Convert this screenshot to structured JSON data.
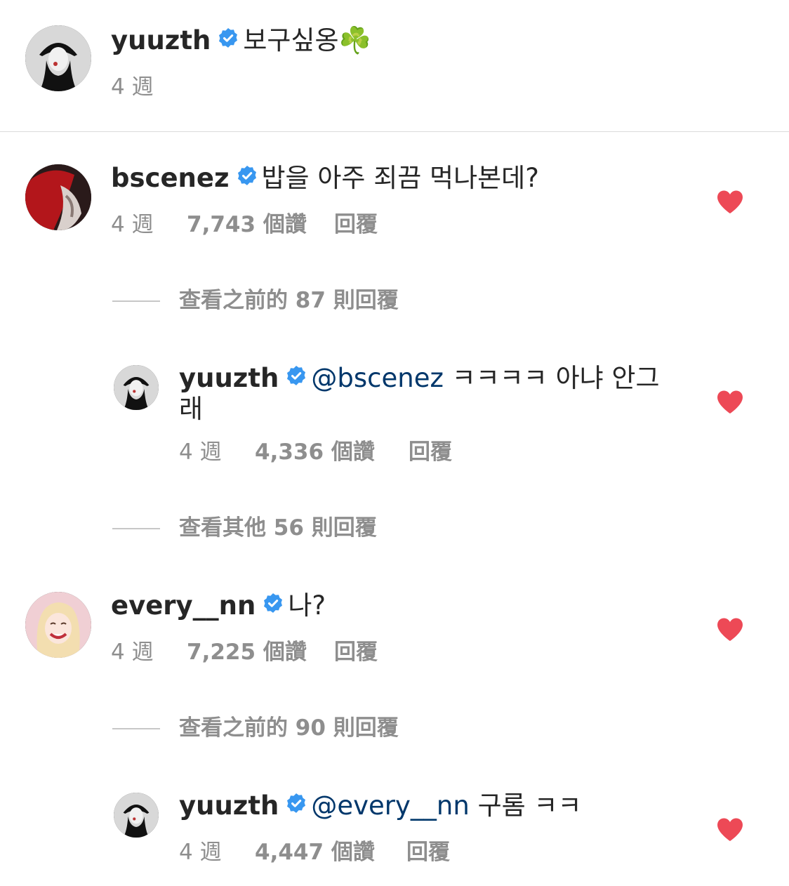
{
  "caption": {
    "username": "yuuzth",
    "text": "보구싶옹☘️",
    "time": "4 週"
  },
  "comments": [
    {
      "username": "bscenez",
      "text": "밥을 아주 죄끔 먹나본데?",
      "time": "4 週",
      "likes": "7,743 個讚",
      "reply_label": "回覆",
      "view_replies": "查看之前的 87 則回覆",
      "reply": {
        "username": "yuuzth",
        "mention": "@bscenez",
        "text_line1": "ㅋㅋㅋㅋ 아냐 안그",
        "text_line2": "래",
        "time": "4 週",
        "likes": "4,336 個讚",
        "reply_label": "回覆"
      },
      "view_more": "查看其他 56 則回覆"
    },
    {
      "username": "every__nn",
      "text": "나?",
      "time": "4 週",
      "likes": "7,225 個讚",
      "reply_label": "回覆",
      "view_replies": "查看之前的 90 則回覆",
      "reply": {
        "username": "yuuzth",
        "mention": "@every__nn",
        "text": "구롬 ㅋㅋ",
        "time": "4 週",
        "likes": "4,447 個讚",
        "reply_label": "回覆"
      }
    }
  ],
  "colors": {
    "verified": "#3897f0",
    "heart": "#ed4956",
    "mention": "#00376b",
    "meta": "#8e8e8e"
  },
  "icons": [
    "verified-badge-icon",
    "heart-icon"
  ]
}
